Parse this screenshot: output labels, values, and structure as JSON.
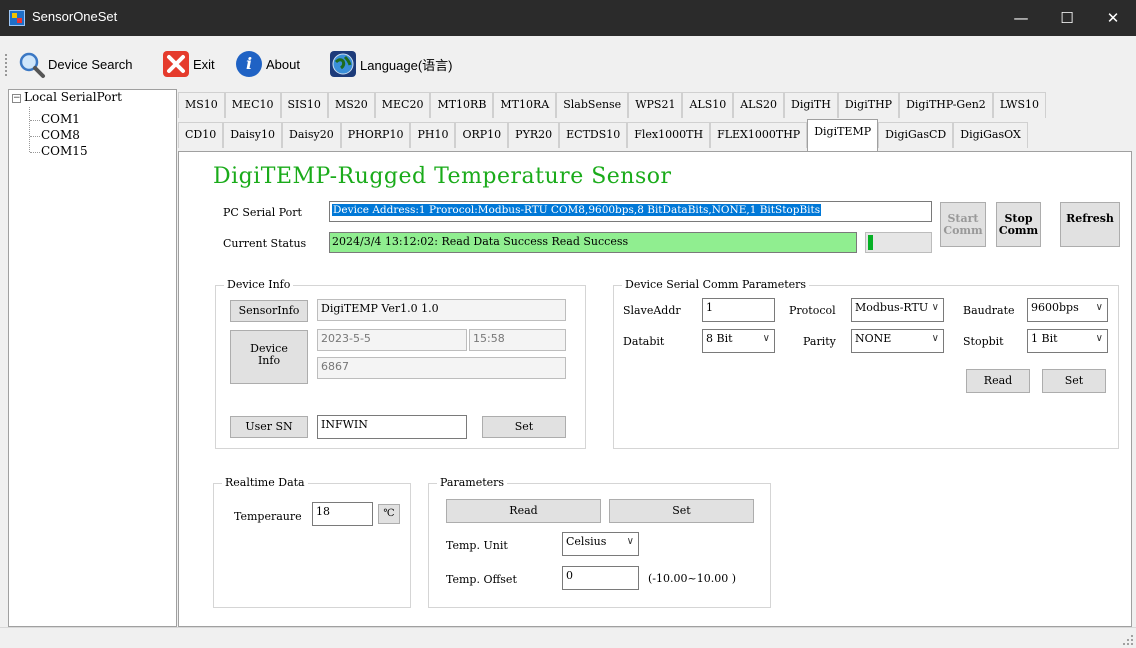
{
  "window": {
    "title": "SensorOneSet",
    "minimize": "—",
    "maximize": "☐",
    "close": "✕"
  },
  "toolbar": {
    "device_search": "Device Search",
    "exit": "Exit",
    "about": "About",
    "language": "Language(语言)"
  },
  "tree": {
    "root": "Local SerialPort",
    "ports": [
      "COM1",
      "COM8",
      "COM15"
    ]
  },
  "tabs_row1": [
    "MS10",
    "MEC10",
    "SIS10",
    "MS20",
    "MEC20",
    "MT10RB",
    "MT10RA",
    "SlabSense",
    "WPS21",
    "ALS10",
    "ALS20",
    "DigiTH",
    "DigiTHP",
    "DigiTHP-Gen2",
    "LWS10"
  ],
  "tabs_row2": [
    "CD10",
    "Daisy10",
    "Daisy20",
    "PHORP10",
    "PH10",
    "ORP10",
    "PYR20",
    "ECTDS10",
    "Flex1000TH",
    "FLEX1000THP",
    "DigiTEMP",
    "DigiGasCD",
    "DigiGasOX"
  ],
  "active_tab": "DigiTEMP",
  "page": {
    "heading": "DigiTEMP-Rugged Temperature Sensor",
    "pc_serial_port_label": "PC Serial Port",
    "pc_serial_port_value": "Device Address:1 Prorocol:Modbus-RTU COM8,9600bps,8 BitDataBits,NONE,1 BitStopBits",
    "current_status_label": "Current Status",
    "current_status_value": "2024/3/4 13:12:02: Read Data Success    Read Success",
    "start_comm": "Start Comm",
    "stop_comm": "Stop Comm",
    "refresh": "Refresh",
    "device_info": {
      "title": "Device Info",
      "sensorinfo_btn": "SensorInfo",
      "sensorinfo_value": "DigiTEMP Ver1.0 1.0",
      "device_info_btn": "Device Info",
      "date": "2023-5-5",
      "time": "15:58",
      "serial": "6867",
      "user_sn_btn": "User SN",
      "user_sn_value": "INFWIN",
      "set_btn": "Set"
    },
    "serial_params": {
      "title": "Device Serial Comm Parameters",
      "slaveaddr_label": "SlaveAddr",
      "slaveaddr_value": "1",
      "protocol_label": "Protocol",
      "protocol_value": "Modbus-RTU",
      "baudrate_label": "Baudrate",
      "baudrate_value": "9600bps",
      "databit_label": "Databit",
      "databit_value": "8 Bit",
      "parity_label": "Parity",
      "parity_value": "NONE",
      "stopbit_label": "Stopbit",
      "stopbit_value": "1 Bit",
      "read_btn": "Read",
      "set_btn": "Set"
    },
    "realtime": {
      "title": "Realtime Data",
      "temperature_label": "Temperaure",
      "temperature_value": "18",
      "unit": "℃"
    },
    "parameters": {
      "title": "Parameters",
      "read_btn": "Read",
      "set_btn": "Set",
      "temp_unit_label": "Temp. Unit",
      "temp_unit_value": "Celsius",
      "temp_offset_label": "Temp. Offset",
      "temp_offset_value": "0",
      "temp_offset_range": "(-10.00~10.00 )"
    }
  },
  "colors": {
    "heading": "#1aab1a",
    "status_bg": "#90ee90",
    "selection_bg": "#0078d7",
    "progress": "#06b025"
  }
}
